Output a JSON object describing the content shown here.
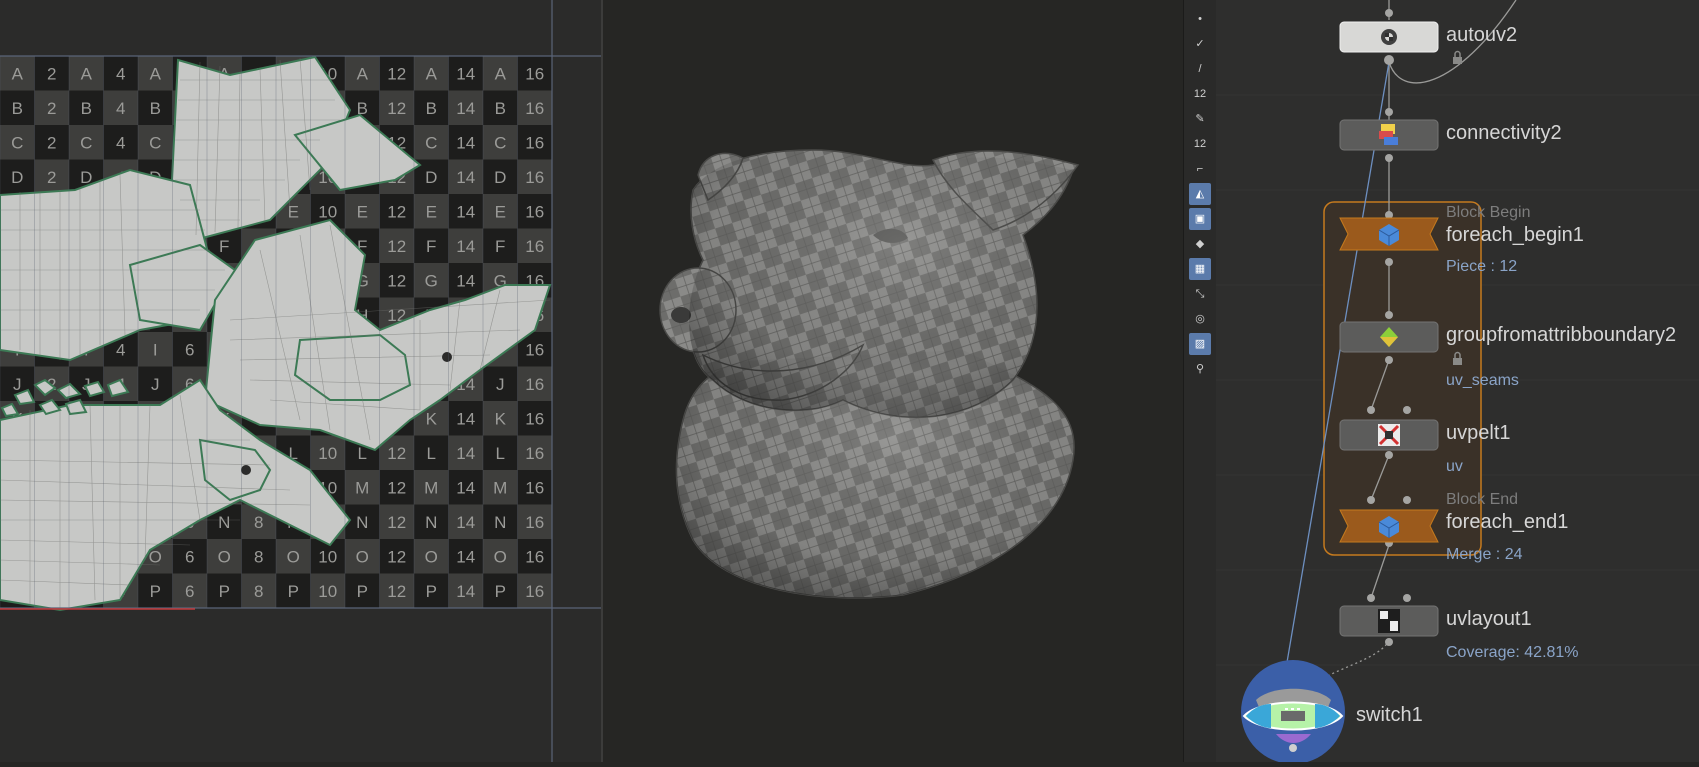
{
  "uv_grid": {
    "row_letters": [
      "A",
      "B",
      "C",
      "D",
      "E",
      "F",
      "G",
      "H",
      "I",
      "J",
      "K",
      "L",
      "M",
      "N",
      "O",
      "P"
    ]
  },
  "shelf_tools": [
    {
      "icon": "dot-icon",
      "glyph": "•",
      "active": false
    },
    {
      "icon": "brush-icon",
      "glyph": "✓",
      "active": false
    },
    {
      "icon": "pen-icon",
      "glyph": "/",
      "active": false
    },
    {
      "icon": "point-number-icon",
      "glyph": "12",
      "active": false
    },
    {
      "icon": "paint-icon",
      "glyph": "✎",
      "active": false
    },
    {
      "icon": "prim-number-icon",
      "glyph": "12",
      "active": false
    },
    {
      "icon": "edge-icon",
      "glyph": "⌐",
      "active": false
    },
    {
      "icon": "shaded-icon",
      "glyph": "◭",
      "active": true
    },
    {
      "icon": "wire-icon",
      "glyph": "▣",
      "active": true
    },
    {
      "icon": "diamond-icon",
      "glyph": "◆",
      "active": false
    },
    {
      "icon": "texture-icon",
      "glyph": "▦",
      "active": true
    },
    {
      "icon": "axis-icon",
      "glyph": "⤡",
      "active": false
    },
    {
      "icon": "ghost-icon",
      "glyph": "◎",
      "active": false
    },
    {
      "icon": "image-icon",
      "glyph": "▨",
      "active": true
    },
    {
      "icon": "pin-icon",
      "glyph": "⚲",
      "active": false
    }
  ],
  "network": {
    "nodes": [
      {
        "id": "autouv2",
        "label": "autouv2"
      },
      {
        "id": "connectivity2",
        "label": "connectivity2"
      },
      {
        "id": "foreach_begin1",
        "label": "foreach_begin1",
        "block": "Block Begin",
        "sub": "Piece : 12"
      },
      {
        "id": "groupfromattribboundary2",
        "label": "groupfromattribboundary2",
        "sub": "uv_seams"
      },
      {
        "id": "uvpelt1",
        "label": "uvpelt1",
        "sub": "uv"
      },
      {
        "id": "foreach_end1",
        "label": "foreach_end1",
        "block": "Block End",
        "sub": "Merge : 24"
      },
      {
        "id": "uvlayout1",
        "label": "uvlayout1",
        "sub": "Coverage: 42.81%"
      },
      {
        "id": "switch1",
        "label": "switch1"
      }
    ]
  },
  "colors": {
    "block_outline": "#c57a1e",
    "block_fill": "#3a3128",
    "node_sub_text": "#8aa4c8",
    "shelf_active": "#5b7bab",
    "uv_shell_fill": "#c7c8c6",
    "uv_shell_edge": "#3c7a55"
  }
}
